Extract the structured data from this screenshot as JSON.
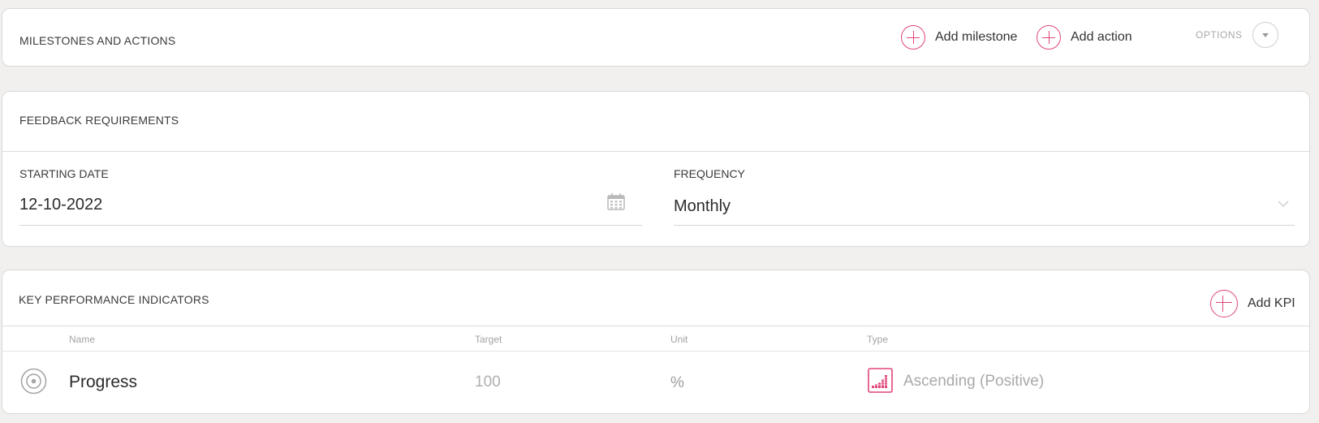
{
  "milestones": {
    "title": "MILESTONES AND ACTIONS",
    "add_milestone_label": "Add milestone",
    "add_action_label": "Add action",
    "options_label": "OPTIONS"
  },
  "feedback": {
    "title": "FEEDBACK REQUIREMENTS",
    "starting_date_label": "STARTING DATE",
    "starting_date_value": "12-10-2022",
    "frequency_label": "FREQUENCY",
    "frequency_value": "Monthly"
  },
  "kpi": {
    "title": "KEY PERFORMANCE INDICATORS",
    "add_kpi_label": "Add KPI",
    "columns": {
      "name": "Name",
      "target": "Target",
      "unit": "Unit",
      "type": "Type"
    },
    "rows": [
      {
        "name": "Progress",
        "target": "100",
        "unit": "%",
        "type": "Ascending (Positive)"
      }
    ]
  },
  "colors": {
    "accent": "#e0457b",
    "muted": "#a3a3a3"
  },
  "icons": [
    "plus-circle-icon",
    "chevron-down-icon",
    "calendar-icon",
    "target-icon",
    "ascending-bars-icon"
  ]
}
